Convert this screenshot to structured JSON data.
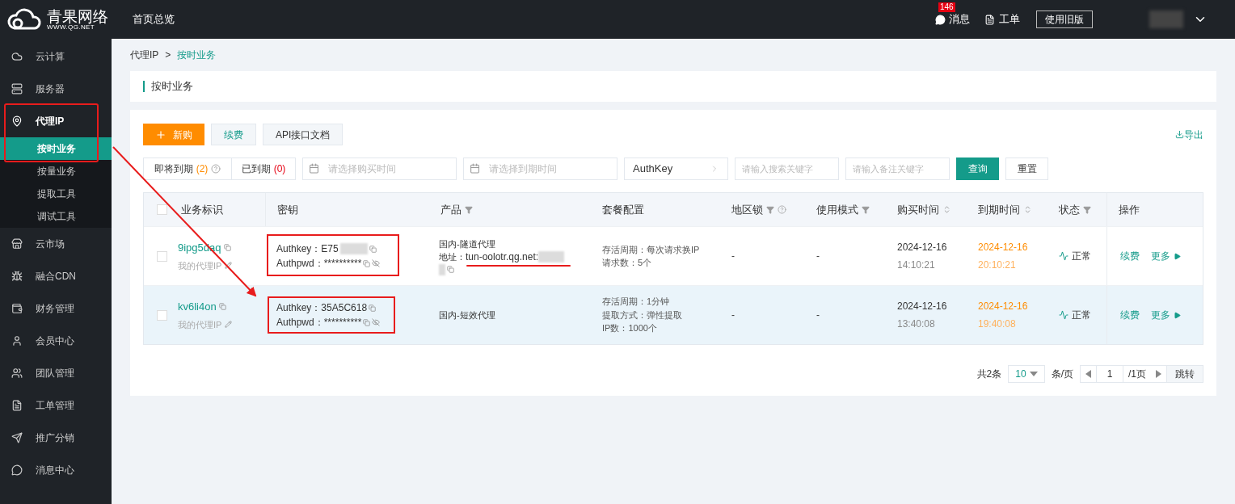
{
  "header": {
    "logo_name": "青果网络",
    "logo_url": "WWW.QG.NET",
    "nav": "首页总览",
    "messages": {
      "label": "消息",
      "badge": "146"
    },
    "tickets": "工单",
    "old_version": "使用旧版"
  },
  "sidebar": [
    {
      "label": "云计算",
      "selected": false
    },
    {
      "label": "服务器",
      "selected": false
    },
    {
      "label": "代理IP",
      "selected": true,
      "children": [
        {
          "label": "按时业务",
          "selected": true
        },
        {
          "label": "按量业务",
          "selected": false
        },
        {
          "label": "提取工具",
          "selected": false
        },
        {
          "label": "调试工具",
          "selected": false
        }
      ]
    },
    {
      "label": "云市场",
      "selected": false
    },
    {
      "label": "融合CDN",
      "selected": false
    },
    {
      "label": "财务管理",
      "selected": false
    },
    {
      "label": "会员中心",
      "selected": false
    },
    {
      "label": "团队管理",
      "selected": false
    },
    {
      "label": "工单管理",
      "selected": false
    },
    {
      "label": "推广分销",
      "selected": false
    },
    {
      "label": "消息中心",
      "selected": false
    }
  ],
  "breadcrumb": {
    "parent": "代理IP",
    "separator": ">",
    "current": "按时业务"
  },
  "page_title": "按时业务",
  "toolbar": {
    "new": "新购",
    "renew": "续费",
    "api": "API接口文档",
    "export": "导出"
  },
  "filters": {
    "expiring": {
      "label": "即将到期",
      "count": "(2)"
    },
    "expired": {
      "label": "已到期",
      "count": "(0)"
    },
    "buy_time": {
      "placeholder": "请选择购买时间"
    },
    "expire_time": {
      "placeholder": "请选择到期时间"
    },
    "field": "AuthKey",
    "keyword": {
      "placeholder": "请输入搜索关键字"
    },
    "remark": {
      "placeholder": "请输入备注关键字"
    },
    "query": "查询",
    "reset": "重置"
  },
  "table": {
    "all_checked": false,
    "columns": [
      {
        "label": "业务标识",
        "kind": "plain"
      },
      {
        "label": "密钥",
        "kind": "plain"
      },
      {
        "label": "产品",
        "kind": "filter"
      },
      {
        "label": "套餐配置",
        "kind": "plain"
      },
      {
        "label": "地区锁",
        "kind": "filter_help"
      },
      {
        "label": "使用模式",
        "kind": "filter"
      },
      {
        "label": "购买时间",
        "kind": "sort"
      },
      {
        "label": "到期时间",
        "kind": "sort"
      },
      {
        "label": "状态",
        "kind": "filter"
      },
      {
        "label": "操作",
        "kind": "plain"
      }
    ],
    "rows": [
      {
        "checked": false,
        "highlighted": false,
        "id": "9ipg5daq",
        "remark": "我的代理IP",
        "authkey_label": "Authkey：",
        "authkey": "E75",
        "authkey_redacted": true,
        "authpwd_label": "Authpwd：",
        "authpwd": "**********",
        "product": "国内-隧道代理",
        "address_label": "地址：",
        "address": "tun-oolotr.qg.net:",
        "config": [
          "存活周期：每次请求换IP",
          "请求数：5个"
        ],
        "region": "-",
        "mode": "-",
        "buy_date": "2024-12-16",
        "buy_time": "14:10:21",
        "expire_date": "2024-12-16",
        "expire_time": "20:10:21",
        "status": "正常",
        "actions": [
          "续费",
          "更多"
        ]
      },
      {
        "checked": false,
        "highlighted": true,
        "id": "kv6li4on",
        "remark": "我的代理IP",
        "authkey_label": "Authkey：",
        "authkey": "35A5C618",
        "authkey_redacted": false,
        "authpwd_label": "Authpwd：",
        "authpwd": "**********",
        "product": "国内-短效代理",
        "config": [
          "存活周期：1分钟",
          "提取方式：弹性提取",
          "IP数：1000个"
        ],
        "region": "-",
        "mode": "-",
        "buy_date": "2024-12-16",
        "buy_time": "13:40:08",
        "expire_date": "2024-12-16",
        "expire_time": "19:40:08",
        "status": "正常",
        "actions": [
          "续费",
          "更多"
        ]
      }
    ]
  },
  "pagination": {
    "total": "共2条",
    "page_size": "10",
    "per_page": "条/页",
    "page": "1",
    "pages": "/1页",
    "jump": "跳转"
  }
}
